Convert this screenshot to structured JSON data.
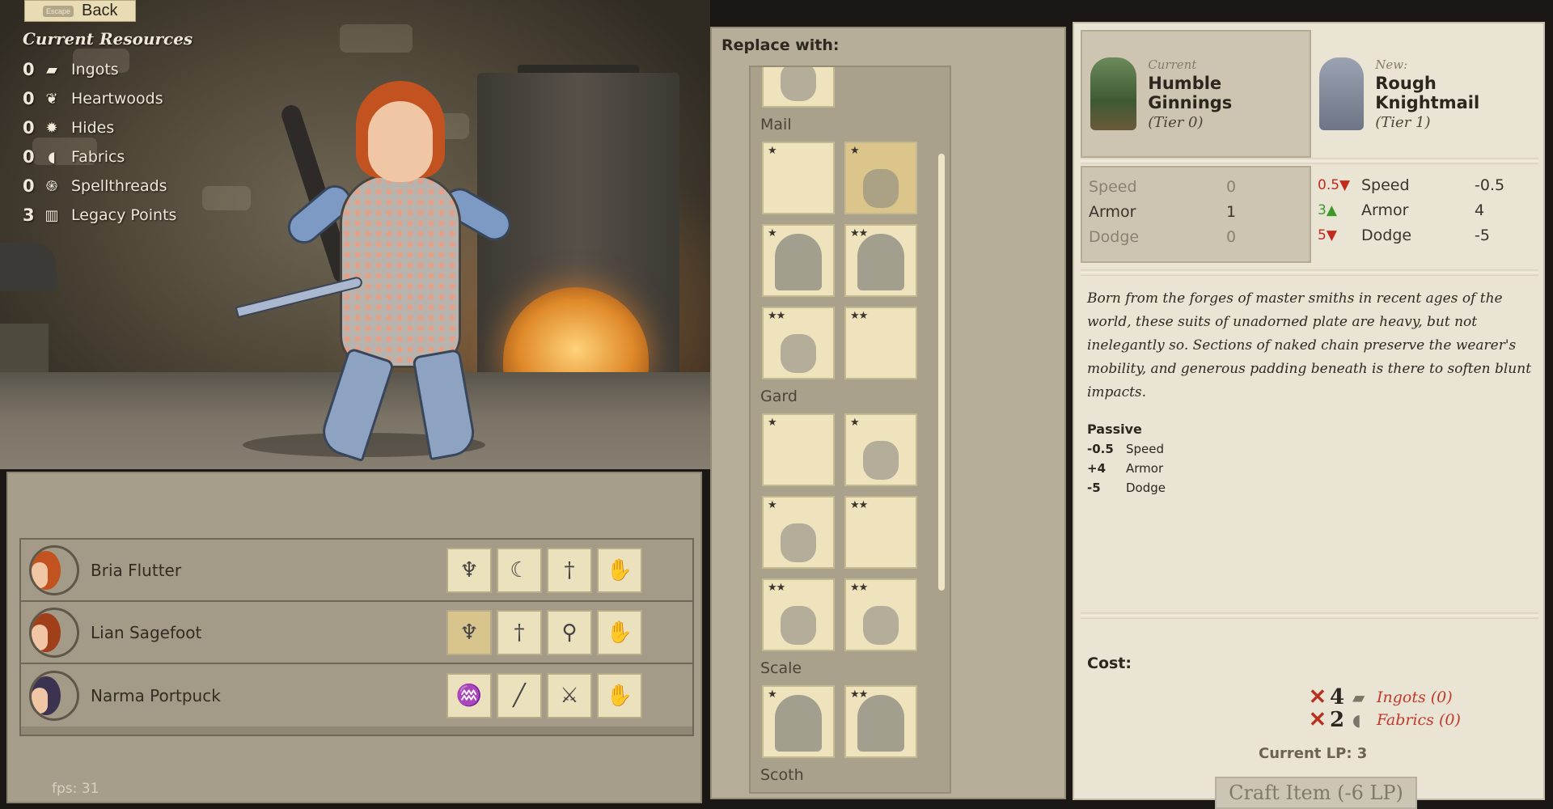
{
  "back_button": {
    "key_hint": "Escape",
    "label": "Back"
  },
  "resources": {
    "title": "Current Resources",
    "items": [
      {
        "count": "0",
        "name": "Ingots",
        "icon": "ingot-icon"
      },
      {
        "count": "0",
        "name": "Heartwoods",
        "icon": "leaf-icon"
      },
      {
        "count": "0",
        "name": "Hides",
        "icon": "hide-icon"
      },
      {
        "count": "0",
        "name": "Fabrics",
        "icon": "fabric-icon"
      },
      {
        "count": "0",
        "name": "Spellthreads",
        "icon": "spiral-icon"
      },
      {
        "count": "3",
        "name": "Legacy Points",
        "icon": "book-icon"
      }
    ]
  },
  "party": [
    {
      "name": "Bria Flutter",
      "hair": "#c2521f",
      "slots": [
        "armor-icon",
        "bow-icon",
        "dagger-icon",
        "hand-icon"
      ]
    },
    {
      "name": "Lian Sagefoot",
      "hair": "#a0401a",
      "slots": [
        "armor-icon",
        "dagger-icon",
        "club-icon",
        "hand-icon"
      ]
    },
    {
      "name": "Narma Portpuck",
      "hair": "#3b3350",
      "slots": [
        "robe-icon",
        "staff-icon",
        "sword-icon",
        "hand-icon"
      ]
    }
  ],
  "fps": "fps: 31",
  "replace": {
    "title": "Replace with:",
    "categories": [
      {
        "name": "Mail",
        "tiles": [
          {
            "stars": "★",
            "sil": "none"
          },
          {
            "stars": "★",
            "sil": "small",
            "selected": true
          },
          {
            "stars": "★",
            "sil": "full"
          },
          {
            "stars": "★★",
            "sil": "full"
          },
          {
            "stars": "★★",
            "sil": "small"
          },
          {
            "stars": "★★",
            "sil": "none"
          }
        ]
      },
      {
        "name": "Gard",
        "tiles": [
          {
            "stars": "★",
            "sil": "none"
          },
          {
            "stars": "★",
            "sil": "small"
          },
          {
            "stars": "★",
            "sil": "small"
          },
          {
            "stars": "★★",
            "sil": "none"
          },
          {
            "stars": "★★",
            "sil": "small"
          },
          {
            "stars": "★★",
            "sil": "small"
          }
        ]
      },
      {
        "name": "Scale",
        "tiles": [
          {
            "stars": "★",
            "sil": "full"
          },
          {
            "stars": "★★",
            "sil": "full"
          }
        ]
      },
      {
        "name": "Scoth",
        "tiles": []
      }
    ]
  },
  "details": {
    "current": {
      "label": "Current",
      "name": "Humble Ginnings",
      "tier": "(Tier 0)"
    },
    "new": {
      "label": "New:",
      "name": "Rough Knightmail",
      "tier": "(Tier 1)"
    },
    "current_stats": [
      {
        "name": "Speed",
        "value": "0",
        "muted": true
      },
      {
        "name": "Armor",
        "value": "1",
        "muted": false
      },
      {
        "name": "Dodge",
        "value": "0",
        "muted": true
      }
    ],
    "new_stats": [
      {
        "delta": "0.5",
        "dir": "down",
        "name": "Speed",
        "value": "-0.5"
      },
      {
        "delta": "3",
        "dir": "up",
        "name": "Armor",
        "value": "4"
      },
      {
        "delta": "5",
        "dir": "down",
        "name": "Dodge",
        "value": "-5"
      }
    ],
    "description": "Born from the forges of master smiths in recent ages of the world, these suits of unadorned plate are heavy, but not inelegantly so. Sections of naked chain preserve the wearer's mobility, and generous padding beneath is there to soften blunt impacts.",
    "passive": {
      "title": "Passive",
      "items": [
        {
          "value": "-0.5",
          "name": "Speed"
        },
        {
          "value": "+4",
          "name": "Armor"
        },
        {
          "value": "-5",
          "name": "Dodge"
        }
      ]
    },
    "cost": {
      "title": "Cost:",
      "items": [
        {
          "amount": "4",
          "resource": "Ingots (0)",
          "icon": "ingot-icon"
        },
        {
          "amount": "2",
          "resource": "Fabrics (0)",
          "icon": "fabric-icon"
        }
      ],
      "current_lp": "Current LP: 3",
      "craft_label": "Craft Item (-6 LP)"
    }
  }
}
